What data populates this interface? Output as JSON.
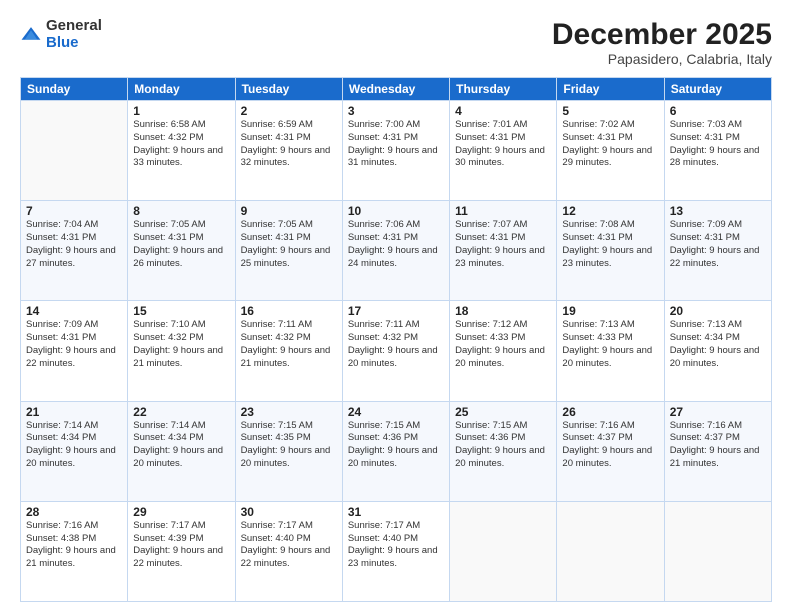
{
  "logo": {
    "general": "General",
    "blue": "Blue"
  },
  "header": {
    "month": "December 2025",
    "location": "Papasidero, Calabria, Italy"
  },
  "weekdays": [
    "Sunday",
    "Monday",
    "Tuesday",
    "Wednesday",
    "Thursday",
    "Friday",
    "Saturday"
  ],
  "weeks": [
    [
      {
        "day": "",
        "info": ""
      },
      {
        "day": "1",
        "info": "Sunrise: 6:58 AM\nSunset: 4:32 PM\nDaylight: 9 hours\nand 33 minutes."
      },
      {
        "day": "2",
        "info": "Sunrise: 6:59 AM\nSunset: 4:31 PM\nDaylight: 9 hours\nand 32 minutes."
      },
      {
        "day": "3",
        "info": "Sunrise: 7:00 AM\nSunset: 4:31 PM\nDaylight: 9 hours\nand 31 minutes."
      },
      {
        "day": "4",
        "info": "Sunrise: 7:01 AM\nSunset: 4:31 PM\nDaylight: 9 hours\nand 30 minutes."
      },
      {
        "day": "5",
        "info": "Sunrise: 7:02 AM\nSunset: 4:31 PM\nDaylight: 9 hours\nand 29 minutes."
      },
      {
        "day": "6",
        "info": "Sunrise: 7:03 AM\nSunset: 4:31 PM\nDaylight: 9 hours\nand 28 minutes."
      }
    ],
    [
      {
        "day": "7",
        "info": "Sunrise: 7:04 AM\nSunset: 4:31 PM\nDaylight: 9 hours\nand 27 minutes."
      },
      {
        "day": "8",
        "info": "Sunrise: 7:05 AM\nSunset: 4:31 PM\nDaylight: 9 hours\nand 26 minutes."
      },
      {
        "day": "9",
        "info": "Sunrise: 7:05 AM\nSunset: 4:31 PM\nDaylight: 9 hours\nand 25 minutes."
      },
      {
        "day": "10",
        "info": "Sunrise: 7:06 AM\nSunset: 4:31 PM\nDaylight: 9 hours\nand 24 minutes."
      },
      {
        "day": "11",
        "info": "Sunrise: 7:07 AM\nSunset: 4:31 PM\nDaylight: 9 hours\nand 23 minutes."
      },
      {
        "day": "12",
        "info": "Sunrise: 7:08 AM\nSunset: 4:31 PM\nDaylight: 9 hours\nand 23 minutes."
      },
      {
        "day": "13",
        "info": "Sunrise: 7:09 AM\nSunset: 4:31 PM\nDaylight: 9 hours\nand 22 minutes."
      }
    ],
    [
      {
        "day": "14",
        "info": "Sunrise: 7:09 AM\nSunset: 4:31 PM\nDaylight: 9 hours\nand 22 minutes."
      },
      {
        "day": "15",
        "info": "Sunrise: 7:10 AM\nSunset: 4:32 PM\nDaylight: 9 hours\nand 21 minutes."
      },
      {
        "day": "16",
        "info": "Sunrise: 7:11 AM\nSunset: 4:32 PM\nDaylight: 9 hours\nand 21 minutes."
      },
      {
        "day": "17",
        "info": "Sunrise: 7:11 AM\nSunset: 4:32 PM\nDaylight: 9 hours\nand 20 minutes."
      },
      {
        "day": "18",
        "info": "Sunrise: 7:12 AM\nSunset: 4:33 PM\nDaylight: 9 hours\nand 20 minutes."
      },
      {
        "day": "19",
        "info": "Sunrise: 7:13 AM\nSunset: 4:33 PM\nDaylight: 9 hours\nand 20 minutes."
      },
      {
        "day": "20",
        "info": "Sunrise: 7:13 AM\nSunset: 4:34 PM\nDaylight: 9 hours\nand 20 minutes."
      }
    ],
    [
      {
        "day": "21",
        "info": "Sunrise: 7:14 AM\nSunset: 4:34 PM\nDaylight: 9 hours\nand 20 minutes."
      },
      {
        "day": "22",
        "info": "Sunrise: 7:14 AM\nSunset: 4:34 PM\nDaylight: 9 hours\nand 20 minutes."
      },
      {
        "day": "23",
        "info": "Sunrise: 7:15 AM\nSunset: 4:35 PM\nDaylight: 9 hours\nand 20 minutes."
      },
      {
        "day": "24",
        "info": "Sunrise: 7:15 AM\nSunset: 4:36 PM\nDaylight: 9 hours\nand 20 minutes."
      },
      {
        "day": "25",
        "info": "Sunrise: 7:15 AM\nSunset: 4:36 PM\nDaylight: 9 hours\nand 20 minutes."
      },
      {
        "day": "26",
        "info": "Sunrise: 7:16 AM\nSunset: 4:37 PM\nDaylight: 9 hours\nand 20 minutes."
      },
      {
        "day": "27",
        "info": "Sunrise: 7:16 AM\nSunset: 4:37 PM\nDaylight: 9 hours\nand 21 minutes."
      }
    ],
    [
      {
        "day": "28",
        "info": "Sunrise: 7:16 AM\nSunset: 4:38 PM\nDaylight: 9 hours\nand 21 minutes."
      },
      {
        "day": "29",
        "info": "Sunrise: 7:17 AM\nSunset: 4:39 PM\nDaylight: 9 hours\nand 22 minutes."
      },
      {
        "day": "30",
        "info": "Sunrise: 7:17 AM\nSunset: 4:40 PM\nDaylight: 9 hours\nand 22 minutes."
      },
      {
        "day": "31",
        "info": "Sunrise: 7:17 AM\nSunset: 4:40 PM\nDaylight: 9 hours\nand 23 minutes."
      },
      {
        "day": "",
        "info": ""
      },
      {
        "day": "",
        "info": ""
      },
      {
        "day": "",
        "info": ""
      }
    ]
  ]
}
